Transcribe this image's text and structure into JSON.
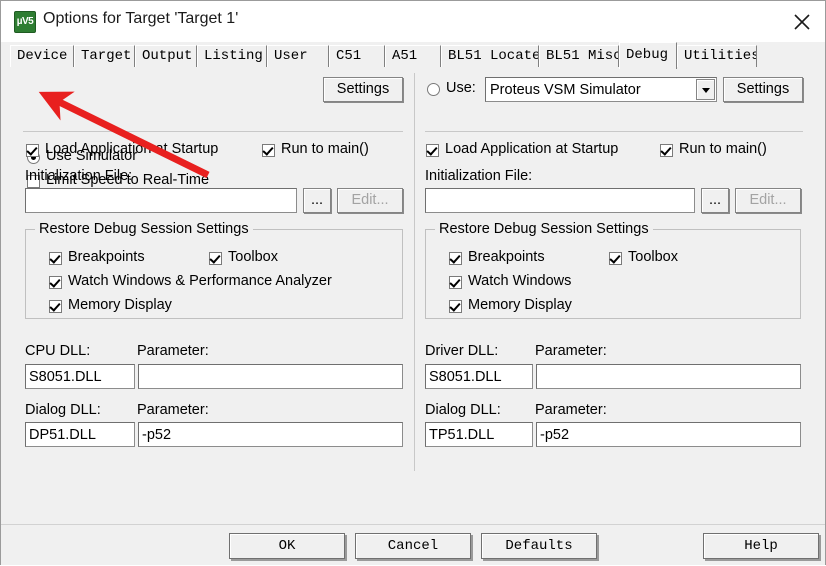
{
  "window": {
    "title": "Options for Target 'Target 1'",
    "icon_label": "µV5",
    "close_icon": "close-icon"
  },
  "tabs": [
    {
      "label": "Device",
      "selected": false
    },
    {
      "label": "Target",
      "selected": false
    },
    {
      "label": "Output",
      "selected": false
    },
    {
      "label": "Listing",
      "selected": false
    },
    {
      "label": "User",
      "selected": false
    },
    {
      "label": "C51",
      "selected": false
    },
    {
      "label": "A51",
      "selected": false
    },
    {
      "label": "BL51 Locate",
      "selected": false
    },
    {
      "label": "BL51 Misc",
      "selected": false
    },
    {
      "label": "Debug",
      "selected": true
    },
    {
      "label": "Utilities",
      "selected": false
    }
  ],
  "left_pane": {
    "use_simulator_label": "Use Simulator",
    "use_simulator_checked": true,
    "limit_speed_label": "Limit Speed to Real-Time",
    "limit_speed_checked": false,
    "settings_button": "Settings",
    "load_app_label": "Load Application at Startup",
    "load_app_checked": true,
    "run_to_main_label": "Run to main()",
    "run_to_main_checked": true,
    "init_file_label": "Initialization File:",
    "init_file_value": "",
    "browse_button": "...",
    "edit_button": "Edit...",
    "edit_button_enabled": false,
    "group_title": "Restore Debug Session Settings",
    "breakpoints_label": "Breakpoints",
    "breakpoints_checked": true,
    "toolbox_label": "Toolbox",
    "toolbox_checked": true,
    "watch_label": "Watch Windows & Performance Analyzer",
    "watch_checked": true,
    "memory_label": "Memory Display",
    "memory_checked": true,
    "cpu_dll_label": "CPU DLL:",
    "cpu_dll_value": "S8051.DLL",
    "cpu_param_label": "Parameter:",
    "cpu_param_value": "",
    "dialog_dll_label": "Dialog DLL:",
    "dialog_dll_value": "DP51.DLL",
    "dialog_param_label": "Parameter:",
    "dialog_param_value": "-p52"
  },
  "right_pane": {
    "use_label": "Use:",
    "use_checked": false,
    "driver_selected": "Proteus VSM Simulator",
    "driver_options": [
      "Proteus VSM Simulator"
    ],
    "settings_button": "Settings",
    "load_app_label": "Load Application at Startup",
    "load_app_checked": true,
    "run_to_main_label": "Run to main()",
    "run_to_main_checked": true,
    "init_file_label": "Initialization File:",
    "init_file_value": "",
    "browse_button": "...",
    "edit_button": "Edit...",
    "edit_button_enabled": false,
    "group_title": "Restore Debug Session Settings",
    "breakpoints_label": "Breakpoints",
    "breakpoints_checked": true,
    "toolbox_label": "Toolbox",
    "toolbox_checked": true,
    "watch_label": "Watch Windows",
    "watch_checked": true,
    "memory_label": "Memory Display",
    "memory_checked": true,
    "driver_dll_label": "Driver DLL:",
    "driver_dll_value": "S8051.DLL",
    "driver_param_label": "Parameter:",
    "driver_param_value": "",
    "dialog_dll_label": "Dialog DLL:",
    "dialog_dll_value": "TP51.DLL",
    "dialog_param_label": "Parameter:",
    "dialog_param_value": "-p52"
  },
  "footer": {
    "ok": "OK",
    "cancel": "Cancel",
    "defaults": "Defaults",
    "help": "Help"
  },
  "annotation": {
    "type": "arrow",
    "color": "#e8201f",
    "points_at": "use-simulator-radio"
  }
}
